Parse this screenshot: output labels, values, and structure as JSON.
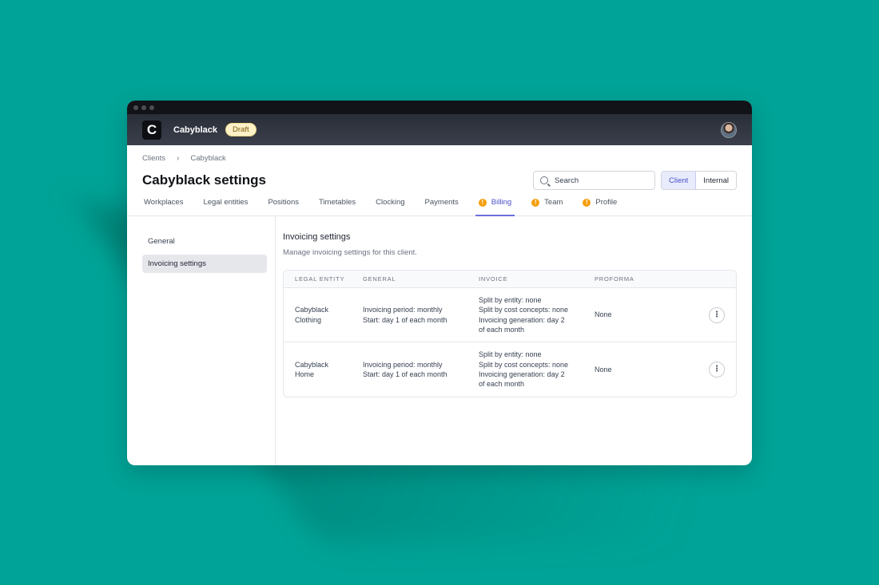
{
  "app": {
    "logo_letter": "C",
    "name": "Cabyblack",
    "status_badge": "Draft"
  },
  "breadcrumb": [
    "Clients",
    "Cabyblack"
  ],
  "page_title": "Cabyblack settings",
  "search": {
    "placeholder": "Search"
  },
  "view_toggle": {
    "options": [
      "Client",
      "Internal"
    ],
    "selected": "Client"
  },
  "tabs": [
    {
      "label": "Workplaces",
      "warning": false
    },
    {
      "label": "Legal entities",
      "warning": false
    },
    {
      "label": "Positions",
      "warning": false
    },
    {
      "label": "Timetables",
      "warning": false
    },
    {
      "label": "Clocking",
      "warning": false
    },
    {
      "label": "Payments",
      "warning": false
    },
    {
      "label": "Billing",
      "warning": true,
      "active": true
    },
    {
      "label": "Team",
      "warning": true
    },
    {
      "label": "Profile",
      "warning": true
    }
  ],
  "warning_glyph": "!",
  "sidenav": [
    {
      "label": "General",
      "active": false
    },
    {
      "label": "Invoicing settings",
      "active": true
    }
  ],
  "section": {
    "title": "Invoicing settings",
    "description": "Manage invoicing settings for this client."
  },
  "table": {
    "headers": [
      "Legal entity",
      "General",
      "Invoice",
      "Proforma"
    ],
    "rows": [
      {
        "entity": "Cabyblack\nClothing",
        "general": "Invoicing period: monthly\nStart: day 1 of each month",
        "invoice": "Split by entity: none\nSplit by cost concepts: none\nInvoicing generation: day 2\nof each month",
        "proforma": "None"
      },
      {
        "entity": "Cabyblack\nHome",
        "general": "Invoicing period: monthly\nStart: day 1 of each month",
        "invoice": "Split by entity: none\nSplit by cost concepts: none\nInvoicing generation: day 2\nof each month",
        "proforma": "None"
      }
    ]
  },
  "colors": {
    "background": "#00a397",
    "accent": "#4a50c8",
    "warning": "#f59e0b"
  },
  "icons": [
    "search-icon",
    "chevron-right-icon",
    "warning-icon",
    "more-vertical-icon",
    "avatar"
  ]
}
